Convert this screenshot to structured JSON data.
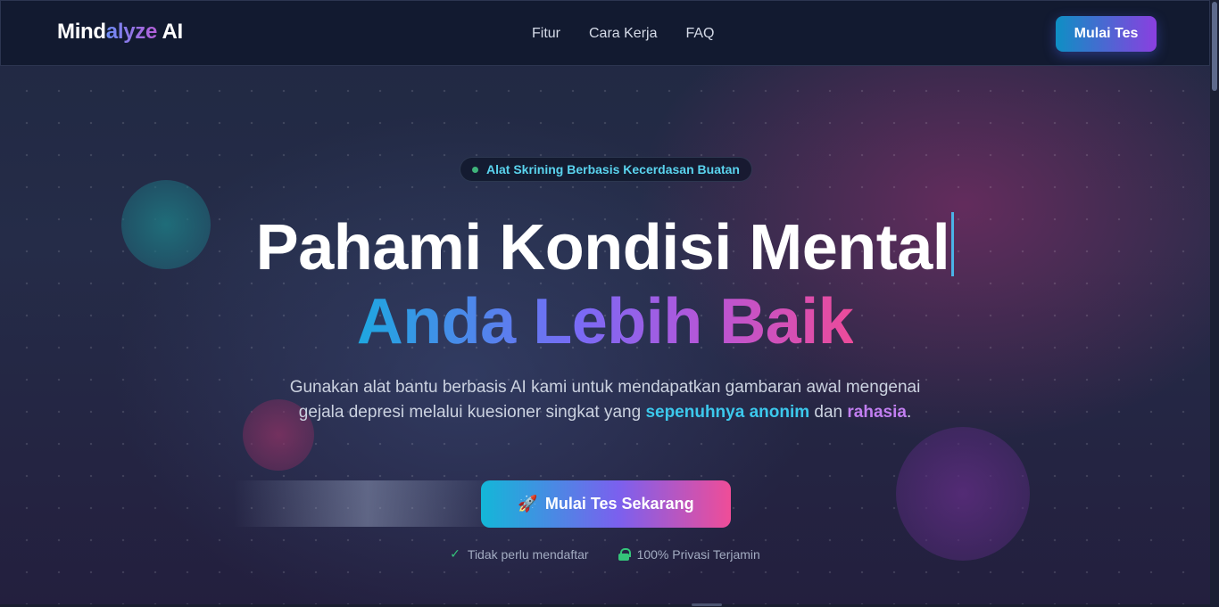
{
  "header": {
    "brand": {
      "part1": "Mind",
      "part2": "alyze",
      "part3": " AI"
    },
    "nav": [
      "Fitur",
      "Cara Kerja",
      "FAQ"
    ],
    "cta_label": "Mulai Tes"
  },
  "hero": {
    "badge": "Alat Skrining Berbasis Kecerdasan Buatan",
    "title_line1": "Pahami Kondisi Mental",
    "title_line2": "Anda Lebih Baik",
    "desc": {
      "text1": "Gunakan alat bantu berbasis AI kami untuk mendapatkan gambaran awal mengenai gejala depresi melalui kuesioner singkat yang ",
      "highlight1": "sepenuhnya anonim",
      "text2": " dan ",
      "highlight2": "rahasia",
      "text3": "."
    },
    "cta_label": "Mulai Tes Sekarang",
    "cta_icon": "🚀",
    "trust": [
      {
        "icon": "check-icon",
        "label": "Tidak perlu mendaftar"
      },
      {
        "icon": "lock-icon",
        "label": "100% Privasi Terjamin"
      }
    ]
  },
  "colors": {
    "accent_cyan": "#3cc8ec",
    "accent_purple": "#c17ef0",
    "accent_pink": "#ec4b9a",
    "success_green": "#35c47a"
  }
}
